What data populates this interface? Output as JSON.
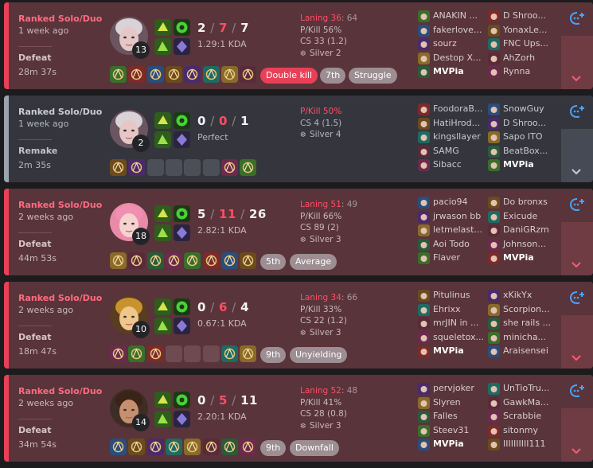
{
  "colors": {
    "defeat": "#e84057",
    "remake": "#9aa4af",
    "deaths": "#ff4e66",
    "accent": "#4aa3ff"
  },
  "matches": [
    {
      "type": "defeat",
      "queue": "Ranked Solo/Duo",
      "time_ago": "1 week ago",
      "result": "Defeat",
      "duration": "28m 37s",
      "champion_level": "13",
      "kills": "2",
      "deaths": "7",
      "assists": "7",
      "kda_ratio": "1.29:1 KDA",
      "laning_label": "Laning 36",
      "laning_value": ": 64",
      "pkill": "P/Kill 56%",
      "cs": "CS 33 (1.2)",
      "tier": "Silver 2",
      "badges": [
        "Double kill",
        "7th",
        "Struggle"
      ],
      "blue_team": [
        "ANAKIN ...",
        "fakerlove...",
        "sourz",
        "Destop X...",
        "MVPia"
      ],
      "red_team": [
        "D Shroo...",
        "YonaxLe...",
        "FNC Ups...",
        "AhZorh",
        "Rynna"
      ],
      "me_team": "blue",
      "me_index": 4
    },
    {
      "type": "remake",
      "queue": "Ranked Solo/Duo",
      "time_ago": "1 week ago",
      "result": "Remake",
      "duration": "2m 35s",
      "champion_level": "2",
      "kills": "0",
      "deaths": "0",
      "assists": "1",
      "kda_ratio": "Perfect",
      "laning_label": "",
      "laning_value": "",
      "pkill": "P/Kill 50%",
      "cs": "CS 4 (1.5)",
      "tier": "Silver 4",
      "badges": [],
      "blue_team": [
        "FoodoraB...",
        "HatiHrod...",
        "kingsllayer",
        "SAMG",
        "Sibacc"
      ],
      "red_team": [
        "SnowGuy",
        "D Shroo...",
        "Sapo ITO",
        "BeatBox...",
        "MVPia"
      ],
      "me_team": "red",
      "me_index": 4
    },
    {
      "type": "defeat",
      "queue": "Ranked Solo/Duo",
      "time_ago": "2 weeks ago",
      "result": "Defeat",
      "duration": "44m 53s",
      "champion_level": "18",
      "kills": "5",
      "deaths": "11",
      "assists": "26",
      "kda_ratio": "2.82:1 KDA",
      "laning_label": "Laning 51",
      "laning_value": ": 49",
      "pkill": "P/Kill 66%",
      "cs": "CS 89 (2)",
      "tier": "Silver 3",
      "badges": [
        "5th",
        "Average"
      ],
      "blue_team": [
        "pacio94",
        "jrwason bb",
        "letmelast...",
        "Aoi Todo",
        "Flaver"
      ],
      "red_team": [
        "Do bronxs",
        "Exicude",
        "DaniGRzm",
        "Johnson...",
        "MVPia"
      ],
      "me_team": "red",
      "me_index": 4
    },
    {
      "type": "defeat",
      "queue": "Ranked Solo/Duo",
      "time_ago": "2 weeks ago",
      "result": "Defeat",
      "duration": "18m 47s",
      "champion_level": "10",
      "kills": "0",
      "deaths": "6",
      "assists": "4",
      "kda_ratio": "0.67:1 KDA",
      "laning_label": "Laning 34",
      "laning_value": ": 66",
      "pkill": "P/Kill 33%",
      "cs": "CS 22 (1.2)",
      "tier": "Silver 3",
      "badges": [
        "9th",
        "Unyielding"
      ],
      "blue_team": [
        "Pitulinus",
        "Ehrixx",
        "mrJIN in ...",
        "squeletox...",
        "MVPia"
      ],
      "red_team": [
        "xKikYx",
        "Scorpion...",
        "she rails ...",
        "minicha...",
        "Araisensei"
      ],
      "me_team": "blue",
      "me_index": 4
    },
    {
      "type": "defeat",
      "queue": "Ranked Solo/Duo",
      "time_ago": "2 weeks ago",
      "result": "Defeat",
      "duration": "34m 54s",
      "champion_level": "14",
      "kills": "0",
      "deaths": "5",
      "assists": "11",
      "kda_ratio": "2.20:1 KDA",
      "laning_label": "Laning 52",
      "laning_value": ": 48",
      "pkill": "P/Kill 41%",
      "cs": "CS 28 (0.8)",
      "tier": "Silver 3",
      "badges": [
        "9th",
        "Downfall"
      ],
      "blue_team": [
        "pervjoker",
        "Slyren",
        "Falles",
        "Steev31",
        "MVPia"
      ],
      "red_team": [
        "UnTioTru...",
        "GawkMa...",
        "Scrabbie",
        "sitonmy",
        "IIIIIIIIII111"
      ],
      "me_team": "blue",
      "me_index": 4
    }
  ]
}
